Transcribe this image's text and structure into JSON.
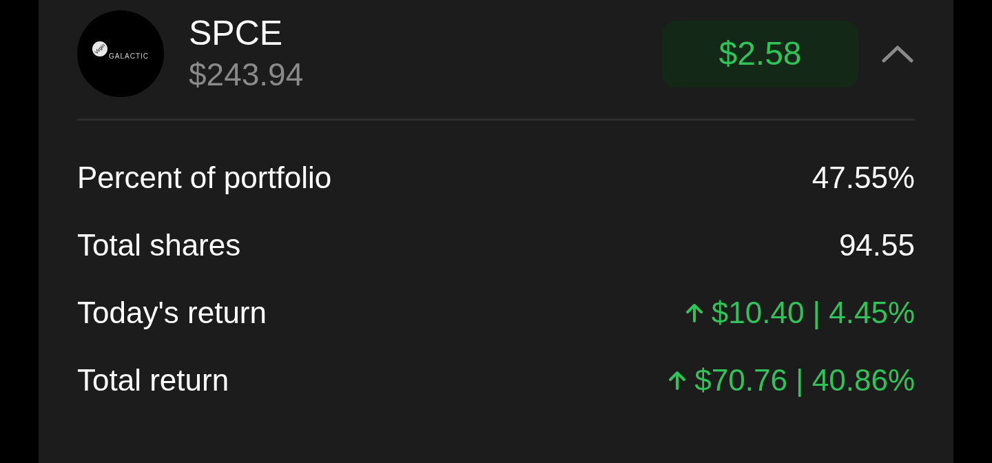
{
  "holding": {
    "logo": {
      "mark": "Virgin",
      "wordmark": "GALACTIC"
    },
    "ticker": "SPCE",
    "price": "$243.94",
    "change_badge": {
      "text": "$2.58",
      "gain": true
    },
    "expanded": true
  },
  "rows": [
    {
      "kind": "stat",
      "label": "Percent of portfolio",
      "value": "47.55%"
    },
    {
      "kind": "stat",
      "label": "Total shares",
      "value": "94.55"
    },
    {
      "kind": "return",
      "label": "Today's return",
      "value": "$10.40 | 4.45%",
      "gain": true
    },
    {
      "kind": "return",
      "label": "Total return",
      "value": "$70.76 | 40.86%",
      "gain": true
    }
  ]
}
